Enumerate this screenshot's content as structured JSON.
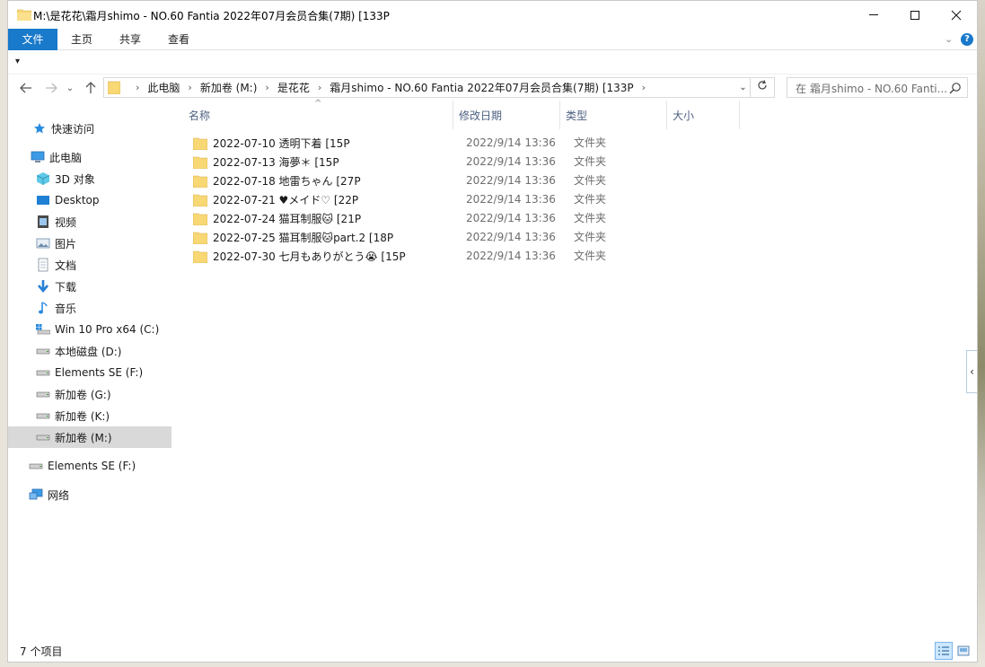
{
  "window": {
    "title": "M:\\是花花\\霜月shimo - NO.60 Fantia 2022年07月会员合集(7期) [133P"
  },
  "ribbon": {
    "tabs": [
      "文件",
      "主页",
      "共享",
      "查看"
    ]
  },
  "address": {
    "crumbs": [
      "此电脑",
      "新加卷 (M:)",
      "是花花",
      "霜月shimo - NO.60 Fantia 2022年07月会员合集(7期) [133P"
    ]
  },
  "search": {
    "placeholder": "在 霜月shimo - NO.60 Fanti..."
  },
  "navpane": {
    "items": [
      {
        "label": "快速访问",
        "icon": "star-icon"
      },
      {
        "label": "此电脑",
        "icon": "computer-icon"
      },
      {
        "label": "3D 对象",
        "icon": "cube-icon"
      },
      {
        "label": "Desktop",
        "icon": "desktop-icon"
      },
      {
        "label": "视频",
        "icon": "video-icon"
      },
      {
        "label": "图片",
        "icon": "pictures-icon"
      },
      {
        "label": "文档",
        "icon": "document-icon"
      },
      {
        "label": "下载",
        "icon": "download-icon"
      },
      {
        "label": "音乐",
        "icon": "music-icon"
      },
      {
        "label": "Win 10 Pro x64 (C:)",
        "icon": "system-drive-icon"
      },
      {
        "label": "本地磁盘 (D:)",
        "icon": "drive-icon"
      },
      {
        "label": "Elements SE (F:)",
        "icon": "drive-icon"
      },
      {
        "label": "新加卷 (G:)",
        "icon": "drive-icon"
      },
      {
        "label": "新加卷 (K:)",
        "icon": "drive-icon"
      },
      {
        "label": "新加卷 (M:)",
        "icon": "drive-icon"
      },
      {
        "label": "Elements SE (F:)",
        "icon": "drive-icon"
      },
      {
        "label": "网络",
        "icon": "network-icon"
      }
    ],
    "selected": "新加卷 (M:)"
  },
  "columns": {
    "name": "名称",
    "date": "修改日期",
    "type": "类型",
    "size": "大小"
  },
  "files": [
    {
      "name": "2022-07-10 透明下着 [15P",
      "date": "2022/9/14 13:36",
      "type": "文件夹"
    },
    {
      "name": "2022-07-13 海夢＊ [15P",
      "date": "2022/9/14 13:36",
      "type": "文件夹"
    },
    {
      "name": "2022-07-18 地雷ちゃん [27P",
      "date": "2022/9/14 13:36",
      "type": "文件夹"
    },
    {
      "name": "2022-07-21 ♥メイド♡ [22P",
      "date": "2022/9/14 13:36",
      "type": "文件夹"
    },
    {
      "name": "2022-07-24 猫耳制服🐱 [21P",
      "date": "2022/9/14 13:36",
      "type": "文件夹"
    },
    {
      "name": "2022-07-25 猫耳制服🐱part.2 [18P",
      "date": "2022/9/14 13:36",
      "type": "文件夹"
    },
    {
      "name": "2022-07-30 七月もありがとう😭 [15P",
      "date": "2022/9/14 13:36",
      "type": "文件夹"
    }
  ],
  "status": {
    "count": "7 个项目"
  },
  "colors": {
    "accent": "#1979ca",
    "folder": "#f8d775",
    "selection": "#d9d9d9"
  }
}
